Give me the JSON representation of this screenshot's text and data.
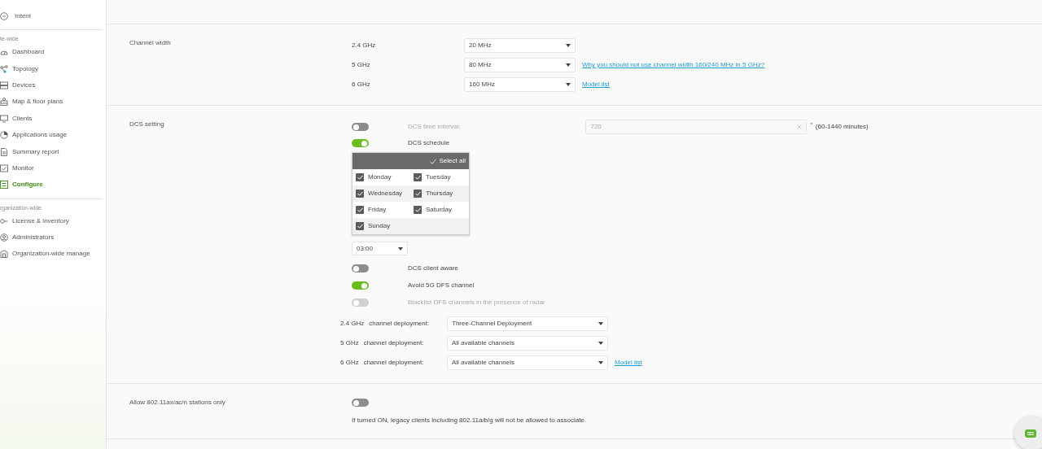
{
  "sidebar": {
    "top_item": {
      "label": "Intent"
    },
    "groups": [
      {
        "title": "te-wide",
        "items": [
          {
            "label": "Dashboard",
            "selected": false
          },
          {
            "label": "Topology",
            "selected": false
          },
          {
            "label": "Devices",
            "selected": false
          },
          {
            "label": "Map & floor plans",
            "selected": false
          },
          {
            "label": "Clients",
            "selected": false
          },
          {
            "label": "Applications usage",
            "selected": false
          },
          {
            "label": "Summary report",
            "selected": false
          },
          {
            "label": "Monitor",
            "selected": false
          },
          {
            "label": "Configure",
            "selected": true
          }
        ]
      },
      {
        "title": "rganization-wide",
        "items": [
          {
            "label": "License & inventory",
            "selected": false
          },
          {
            "label": "Administrators",
            "selected": false
          },
          {
            "label": "Organization-wide manage",
            "selected": false
          }
        ]
      }
    ]
  },
  "channel_width": {
    "title": "Channel width",
    "rows": [
      {
        "band": "2.4 GHz",
        "value": "20 MHz"
      },
      {
        "band": "5 GHz",
        "value": "80 MHz",
        "link": "Why you should not use channel width 160/240 MHz in 5 GHz?"
      },
      {
        "band": "6 GHz",
        "value": "160 MHz",
        "link": "Model list"
      }
    ]
  },
  "dcs_setting": {
    "title": "DCS setting",
    "time_interval": {
      "label": "DCS time interval:",
      "on": false,
      "value": "720",
      "required_mark": "*",
      "hint": "(60-1440 minutes)"
    },
    "schedule": {
      "label": "DCS schedule",
      "on": true
    },
    "days_panel": {
      "select_all": "Select all",
      "days": [
        {
          "label": "Monday",
          "checked": true
        },
        {
          "label": "Tuesday",
          "checked": true
        },
        {
          "label": "Wednesday",
          "checked": true
        },
        {
          "label": "Thursday",
          "checked": true
        },
        {
          "label": "Friday",
          "checked": true
        },
        {
          "label": "Saturday",
          "checked": true
        },
        {
          "label": "Sunday",
          "checked": true
        }
      ]
    },
    "time": "03:00",
    "toggles": [
      {
        "label": "DCS client aware",
        "on": false,
        "disabled": false
      },
      {
        "label": "Avoid 5G DFS channel",
        "on": true,
        "disabled": false
      },
      {
        "label": "Blacklist DFS channels in the presence of radar",
        "on": false,
        "disabled": true
      }
    ],
    "deployments": [
      {
        "band": "2.4 GHz",
        "label": "channel deployment:",
        "value": "Three-Channel Deployment"
      },
      {
        "band": "5 GHz",
        "label": "channel deployment:",
        "value": "All available channels"
      },
      {
        "band": "6 GHz",
        "label": "channel deployment:",
        "value": "All available channels",
        "link": "Model list"
      }
    ]
  },
  "allow_stations": {
    "title": "Allow 802.11ax/ac/n stations only",
    "on": false,
    "note": "If turned ON, legacy clients including 802.11a/b/g will not be allowed to associate."
  }
}
